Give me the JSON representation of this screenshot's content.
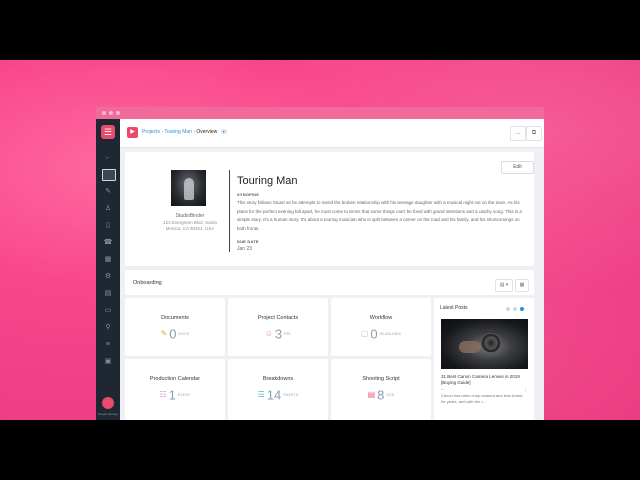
{
  "colors": {
    "accent": "#e94b6f",
    "link": "#2f8fd8",
    "sidebar": "#1f2733"
  },
  "sidebar": {
    "icons": [
      "back-arrow-icon",
      "projects-icon",
      "pencil-icon",
      "user-icon",
      "book-icon",
      "phone-icon",
      "calendar-icon",
      "settings-icon",
      "storyboard-icon",
      "schedule-icon",
      "location-icon",
      "list-icon",
      "film-icon"
    ],
    "user_label": "Neoda Horsley",
    "active_icon": "overview-icon"
  },
  "breadcrumb": {
    "projects": "Projects",
    "project": "Touring Man",
    "current": "Overview",
    "badge": "▾"
  },
  "topbar": {
    "more": "…",
    "share": "⧉"
  },
  "project": {
    "edit_label": "Edit",
    "studio": "StudioBinder",
    "address": "123 Evergreen Blvd, Santa Monica, CA 90401, USA",
    "title": "Touring Man",
    "synopsis_label": "SYNOPSIS",
    "synopsis": "This story follows Stuart as he attempts to mend the broken relationship with his teenage daughter with a musical night out on the town. As his plans for the perfect evening fall apart, he must come to terms that some things can't be fixed with grand intentions and a catchy song. This is a simple story. It's a human story. It's about a touring musician who is split between a career on the road and his family, and his shortcomings on both fronts.",
    "due_label": "DUE DATE",
    "due_date": "Jan 23"
  },
  "onboarding": {
    "title": "Onboarding",
    "filter_btn": "▤ ▾",
    "calendar_btn": "▦",
    "tiles": [
      {
        "title": "Documents",
        "icon": "✎",
        "value": "0",
        "unit": "DOCS"
      },
      {
        "title": "Project Contacts",
        "icon": "☺",
        "value": "3",
        "unit": "PPL"
      },
      {
        "title": "Workflow",
        "icon": "▢",
        "value": "0",
        "unit": "DEADLINES"
      },
      {
        "title": "Production Calendar",
        "icon": "☷",
        "value": "1",
        "unit": "EVENT"
      },
      {
        "title": "Breakdowns",
        "icon": "☰",
        "value": "14",
        "unit": "SHEETS"
      },
      {
        "title": "Shooting Script",
        "icon": "▤",
        "value": "8",
        "unit": "SCN"
      }
    ]
  },
  "latest_posts": {
    "title": "Latest Posts",
    "caption": "31 Best Canon Camera Lenses in 2019 [Buying Guide]",
    "date": "—",
    "text": "Canon has been a top camera and lens brand for years, and with the r...",
    "more": "⋮"
  }
}
